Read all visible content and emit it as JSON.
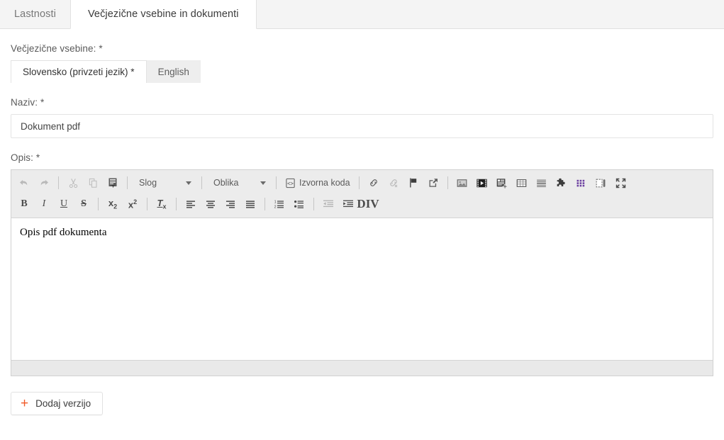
{
  "top_tabs": [
    {
      "label": "Lastnosti",
      "active": false
    },
    {
      "label": "Večjezične vsebine in dokumenti",
      "active": true
    }
  ],
  "form": {
    "multilingual_label": "Večjezične vsebine: *",
    "language_tabs": [
      {
        "label": "Slovensko (privzeti jezik) *",
        "active": true
      },
      {
        "label": "English",
        "active": false
      }
    ],
    "title_label": "Naziv: *",
    "title_value": "Dokument pdf",
    "description_label": "Opis: *",
    "description_content": "Opis pdf dokumenta"
  },
  "editor": {
    "toolbar_row1": [
      {
        "name": "undo-icon",
        "type": "icon",
        "disabled": true
      },
      {
        "name": "redo-icon",
        "type": "icon",
        "disabled": true
      },
      {
        "name": "separator",
        "type": "sep"
      },
      {
        "name": "cut-icon",
        "type": "icon",
        "disabled": true
      },
      {
        "name": "copy-icon",
        "type": "icon",
        "disabled": true
      },
      {
        "name": "paste-text-icon",
        "type": "icon",
        "disabled": false
      },
      {
        "name": "separator",
        "type": "sep"
      },
      {
        "name": "style-combo",
        "type": "combo",
        "label": "Slog"
      },
      {
        "name": "separator",
        "type": "sep"
      },
      {
        "name": "format-combo",
        "type": "combo",
        "label": "Oblika"
      },
      {
        "name": "separator",
        "type": "sep"
      },
      {
        "name": "source-code-button",
        "type": "textbtn",
        "label": "Izvorna koda"
      },
      {
        "name": "separator",
        "type": "sep"
      },
      {
        "name": "link-icon",
        "type": "icon",
        "disabled": false
      },
      {
        "name": "unlink-icon",
        "type": "icon",
        "disabled": true
      },
      {
        "name": "anchor-flag-icon",
        "type": "icon",
        "disabled": false
      },
      {
        "name": "external-link-icon",
        "type": "icon",
        "disabled": false
      },
      {
        "name": "separator",
        "type": "sep"
      },
      {
        "name": "image-icon",
        "type": "icon",
        "disabled": false
      },
      {
        "name": "video-icon",
        "type": "icon",
        "disabled": false
      },
      {
        "name": "document-insert-icon",
        "type": "icon",
        "disabled": false
      },
      {
        "name": "table-icon",
        "type": "icon",
        "disabled": false
      },
      {
        "name": "horizontal-rule-icon",
        "type": "icon",
        "disabled": false
      },
      {
        "name": "puzzle-plugin-icon",
        "type": "icon",
        "disabled": false
      },
      {
        "name": "special-character-icon",
        "type": "icon",
        "disabled": false
      },
      {
        "name": "page-break-icon",
        "type": "icon",
        "disabled": false
      },
      {
        "name": "maximize-icon",
        "type": "icon",
        "disabled": false
      }
    ],
    "toolbar_row2": [
      {
        "name": "bold-button",
        "type": "bold",
        "label": "B"
      },
      {
        "name": "italic-button",
        "type": "italic",
        "label": "I"
      },
      {
        "name": "underline-button",
        "type": "underline",
        "label": "U"
      },
      {
        "name": "strikethrough-button",
        "type": "strike",
        "label": "S"
      },
      {
        "name": "separator",
        "type": "sep"
      },
      {
        "name": "subscript-button",
        "type": "sub",
        "label": "x",
        "script": "2"
      },
      {
        "name": "superscript-button",
        "type": "sup",
        "label": "x",
        "script": "2"
      },
      {
        "name": "separator",
        "type": "sep"
      },
      {
        "name": "remove-format-button",
        "type": "removefmt",
        "label": "T",
        "script": "x"
      },
      {
        "name": "separator",
        "type": "sep"
      },
      {
        "name": "align-left-icon",
        "type": "icon",
        "disabled": false
      },
      {
        "name": "align-center-icon",
        "type": "icon",
        "disabled": false
      },
      {
        "name": "align-right-icon",
        "type": "icon",
        "disabled": false
      },
      {
        "name": "align-justify-icon",
        "type": "icon",
        "disabled": false
      },
      {
        "name": "separator",
        "type": "sep"
      },
      {
        "name": "numbered-list-icon",
        "type": "icon",
        "disabled": false
      },
      {
        "name": "bulleted-list-icon",
        "type": "icon",
        "disabled": false
      },
      {
        "name": "separator",
        "type": "sep"
      },
      {
        "name": "outdent-icon",
        "type": "icon",
        "disabled": true
      },
      {
        "name": "indent-icon",
        "type": "icon",
        "disabled": false
      },
      {
        "name": "blockquote-icon",
        "type": "quote",
        "label": "”"
      },
      {
        "name": "div-container-icon",
        "type": "div",
        "label": "DIV",
        "sub": "</>"
      }
    ],
    "source_code_label": "Izvorna koda",
    "style_label": "Slog",
    "format_label": "Oblika"
  },
  "footer": {
    "add_version_label": "Dodaj verzijo",
    "plus_glyph": "+"
  },
  "colors": {
    "accent_orange": "#f05a28",
    "tab_active_bg": "#ffffff",
    "tabstrip_bg": "#f4f4f4",
    "toolbar_bg": "#ececec",
    "special_char_purple": "#6b3fa0"
  }
}
